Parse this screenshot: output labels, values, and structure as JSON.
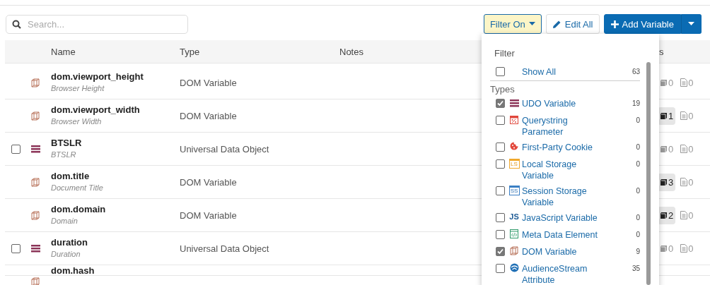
{
  "search": {
    "placeholder": "Search..."
  },
  "toolbar": {
    "filter_button": {
      "label": "Filter On",
      "active": true
    },
    "edit_button": {
      "label": "Edit All"
    },
    "add_button": {
      "label": "Add Variable"
    }
  },
  "table": {
    "columns": [
      "Name",
      "Type",
      "Notes",
      "s"
    ],
    "rows": [
      {
        "kind": "dom",
        "name": "dom.viewport_height",
        "description": "Browser Height",
        "type": "DOM Variable",
        "usage": [
          {
            "count": "0",
            "highlighted": false
          },
          {
            "count": "0",
            "highlighted": false
          }
        ]
      },
      {
        "kind": "dom",
        "name": "dom.viewport_width",
        "description": "Browser Width",
        "type": "DOM Variable",
        "usage": [
          {
            "count": "1",
            "highlighted": true
          },
          {
            "count": "0",
            "highlighted": false
          }
        ]
      },
      {
        "kind": "udo",
        "checked": false,
        "name": "BTSLR",
        "description": "BTSLR",
        "type": "Universal Data Object",
        "usage": [
          {
            "count": "0",
            "highlighted": false
          },
          {
            "count": "0",
            "highlighted": false
          }
        ]
      },
      {
        "kind": "dom",
        "name": "dom.title",
        "description": "Document Title",
        "type": "DOM Variable",
        "usage": [
          {
            "count": "3",
            "highlighted": true
          },
          {
            "count": "0",
            "highlighted": false
          }
        ]
      },
      {
        "kind": "dom",
        "name": "dom.domain",
        "description": "Domain",
        "type": "DOM Variable",
        "usage": [
          {
            "count": "2",
            "highlighted": true
          },
          {
            "count": "0",
            "highlighted": false
          }
        ]
      },
      {
        "kind": "udo",
        "checked": false,
        "name": "duration",
        "description": "Duration",
        "type": "Universal Data Object",
        "usage": [
          {
            "count": "0",
            "highlighted": false
          },
          {
            "count": "0",
            "highlighted": false
          }
        ]
      },
      {
        "kind": "dom",
        "name": "dom.hash"
      }
    ]
  },
  "filter_menu": {
    "title": "Filter",
    "show_all": {
      "label": "Show All",
      "checked": false,
      "count": "63"
    },
    "types_heading": "Types",
    "types": [
      {
        "kind": "udo",
        "label": "UDO Variable",
        "checked": true,
        "count": "19"
      },
      {
        "kind": "querystring",
        "label": "Querystring Parameter",
        "checked": false,
        "count": "0"
      },
      {
        "kind": "cookie",
        "label": "First-Party Cookie",
        "checked": false,
        "count": "0"
      },
      {
        "kind": "local",
        "icon_text": "LS",
        "label": "Local Storage Variable",
        "checked": false,
        "count": "0"
      },
      {
        "kind": "session",
        "icon_text": "SS",
        "label": "Session Storage Variable",
        "checked": false,
        "count": "0"
      },
      {
        "kind": "js",
        "icon_text": "JS",
        "label": "JavaScript Variable",
        "checked": false,
        "count": "0"
      },
      {
        "kind": "meta",
        "label": "Meta Data Element",
        "checked": false,
        "count": "0"
      },
      {
        "kind": "dom",
        "label": "DOM Variable",
        "checked": true,
        "count": "9"
      },
      {
        "kind": "audience",
        "label": "AudienceStream Attribute",
        "checked": false,
        "count": "35"
      }
    ]
  }
}
